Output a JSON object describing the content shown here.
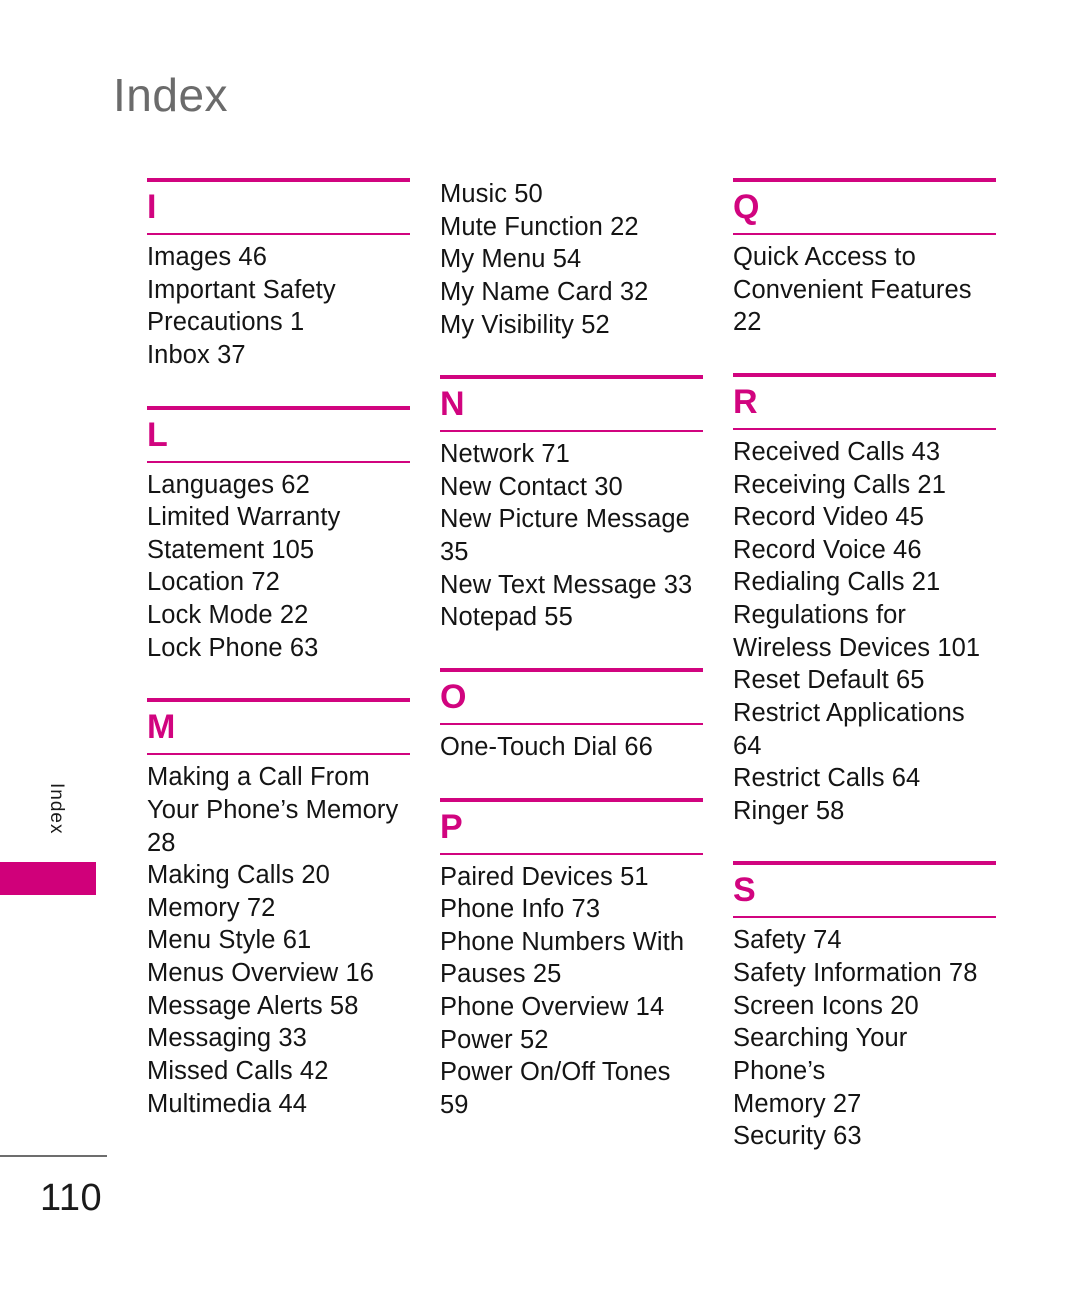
{
  "page": {
    "title": "Index",
    "number": "110",
    "side_tab_label": "Index",
    "accent_color": "#d1047f",
    "tab_color": "#d0007a",
    "title_color": "#6b6b6b"
  },
  "columns": [
    {
      "id": "column-1",
      "blocks": [
        {
          "type": "section",
          "letter": "I",
          "entries": [
            "Images 46",
            "Important Safety",
            "Precautions 1",
            "Inbox 37"
          ]
        },
        {
          "type": "section",
          "letter": "L",
          "entries": [
            "Languages 62",
            "Limited Warranty",
            "Statement 105",
            "Location 72",
            "Lock Mode 22",
            "Lock Phone 63"
          ]
        },
        {
          "type": "section",
          "letter": "M",
          "entries": [
            "Making a Call From",
            "Your Phone’s Memory",
            "28",
            "Making Calls 20",
            "Memory 72",
            "Menu Style 61",
            "Menus Overview 16",
            "Message Alerts 58",
            "Messaging 33",
            "Missed Calls 42",
            "Multimedia 44"
          ]
        }
      ]
    },
    {
      "id": "column-2",
      "blocks": [
        {
          "type": "continuation",
          "letter": "",
          "entries": [
            "Music 50",
            "Mute Function 22",
            "My Menu 54",
            "My Name Card 32",
            "My Visibility 52"
          ]
        },
        {
          "type": "section",
          "letter": "N",
          "entries": [
            "Network 71",
            "New Contact 30",
            "New Picture Message",
            "35",
            "New Text Message 33",
            "Notepad 55"
          ]
        },
        {
          "type": "section",
          "letter": "O",
          "entries": [
            "One-Touch Dial 66"
          ]
        },
        {
          "type": "section",
          "letter": "P",
          "entries": [
            "Paired Devices 51",
            "Phone Info 73",
            "Phone Numbers With",
            "Pauses 25",
            "Phone Overview 14",
            "Power 52",
            "Power On/Off Tones",
            "59"
          ]
        }
      ]
    },
    {
      "id": "column-3",
      "blocks": [
        {
          "type": "section",
          "letter": "Q",
          "entries": [
            "Quick Access to",
            "Convenient Features",
            "22"
          ]
        },
        {
          "type": "section",
          "letter": "R",
          "entries": [
            "Received Calls 43",
            "Receiving Calls 21",
            "Record Video 45",
            "Record Voice 46",
            "Redialing Calls 21",
            "Regulations for",
            "Wireless Devices 101",
            "Reset Default 65",
            "Restrict Applications",
            "64",
            "Restrict Calls 64",
            "Ringer 58"
          ]
        },
        {
          "type": "section",
          "letter": "S",
          "entries": [
            "Safety 74",
            "Safety Information 78",
            "Screen Icons 20",
            "Searching Your Phone’s",
            "Memory 27",
            "Security 63"
          ]
        }
      ]
    }
  ]
}
